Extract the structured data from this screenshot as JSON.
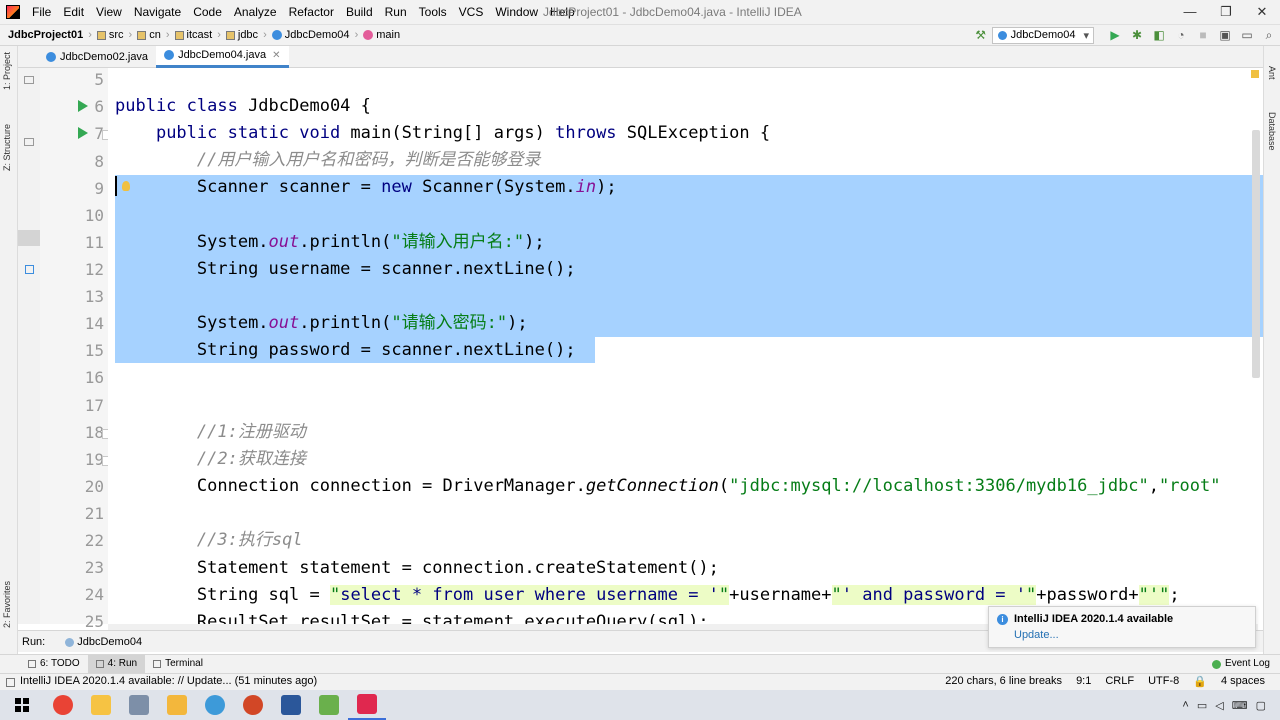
{
  "window": {
    "title": "JdbcProject01 - JdbcDemo04.java - IntelliJ IDEA",
    "menu": [
      "File",
      "Edit",
      "View",
      "Navigate",
      "Code",
      "Analyze",
      "Refactor",
      "Build",
      "Run",
      "Tools",
      "VCS",
      "Window",
      "Help"
    ],
    "controls": {
      "minimize": "—",
      "maximize": "❐",
      "close": "✕"
    }
  },
  "breadcrumb": {
    "project": "JdbcProject01",
    "items": [
      "src",
      "cn",
      "itcast",
      "jdbc",
      "JdbcDemo04",
      "main"
    ]
  },
  "toolbar": {
    "run_config": "JdbcDemo04",
    "icons": [
      "hammer-icon",
      "run-icon",
      "debug-icon",
      "coverage-icon",
      "profile-icon",
      "stop-icon",
      "project-structure-icon",
      "layout-icon",
      "search-icon"
    ]
  },
  "tabs": [
    {
      "label": "JdbcDemo02.java",
      "active": false
    },
    {
      "label": "JdbcDemo04.java",
      "active": true
    }
  ],
  "left_tool_labels": {
    "project": "1: Project",
    "structure": "Z: Structure",
    "favorites": "2: Favorites"
  },
  "right_tool_labels": {
    "ant": "Ant",
    "database": "Database"
  },
  "editor": {
    "line_numbers": [
      "5",
      "6",
      "7",
      "8",
      "9",
      "10",
      "11",
      "12",
      "13",
      "14",
      "15",
      "16",
      "17",
      "18",
      "19",
      "20",
      "21",
      "22",
      "23",
      "24",
      "25"
    ],
    "lines": {
      "l6": {
        "kw1": "public class ",
        "rest": "JdbcDemo04 {"
      },
      "l7": {
        "kw1": "public static void ",
        "a": "main(String[] args) ",
        "kw2": "throws ",
        "b": "SQLException {"
      },
      "l8": {
        "cmt": "//用户输入用户名和密码，判断是否能够登录"
      },
      "l9": {
        "a": "Scanner scanner = ",
        "kw": "new ",
        "b": "Scanner(System.",
        "fld": "in",
        "c": ");"
      },
      "l11": {
        "a": "System.",
        "fld": "out",
        "b": ".println(",
        "str": "\"请输入用户名:\"",
        "c": ");"
      },
      "l12": {
        "a": "String username = scanner.nextLine();"
      },
      "l14": {
        "a": "System.",
        "fld": "out",
        "b": ".println(",
        "str": "\"请输入密码:\"",
        "c": ");"
      },
      "l15": {
        "a": "String password = scanner.nextLine();"
      },
      "l18": {
        "cmt": "//1:注册驱动"
      },
      "l19": {
        "cmt": "//2:获取连接"
      },
      "l20": {
        "a": "Connection connection = DriverManager.",
        "mth": "getConnection",
        "b": "(",
        "str": "\"jdbc:mysql://localhost:3306/mydb16_jdbc\"",
        "c": ",",
        "str2": "\"root\""
      },
      "l22": {
        "cmt": "//3:执行sql"
      },
      "l23": {
        "a": "Statement statement = connection.createStatement();"
      },
      "l24": {
        "a": "String sql = ",
        "str1": "\"",
        "sqlkw": "select * from user where username = '",
        "str2": "\"",
        "b": "+username+",
        "str3": "\"",
        "sqlkw2": "' and password = '",
        "str4": "\"",
        "c": "+password+",
        "str5": "\"'\"",
        "d": ";"
      },
      "l25": {
        "a": "ResultSet resultSet = statement.executeQuery(sql);"
      }
    }
  },
  "run_panel": {
    "label": "Run:",
    "tab": "JdbcDemo04"
  },
  "bottom_tools": [
    {
      "label": "6: TODO",
      "active": false
    },
    {
      "label": "4: Run",
      "active": true
    },
    {
      "label": "Terminal",
      "active": false
    }
  ],
  "event_log": "Event Log",
  "notification": {
    "title": "IntelliJ IDEA 2020.1.4 available",
    "link": "Update..."
  },
  "status": {
    "message": "IntelliJ IDEA 2020.1.4 available: // Update... (51 minutes ago)",
    "chars": "220 chars, 6 line breaks",
    "position": "9:1",
    "line_sep": "CRLF",
    "encoding": "UTF-8",
    "indent": "4 spaces"
  },
  "taskbar": {
    "apps": [
      {
        "name": "chrome-icon",
        "color": "#e94335"
      },
      {
        "name": "file-explorer-icon",
        "color": "#f6c343"
      },
      {
        "name": "app-icon-3",
        "color": "#7d8fa8"
      },
      {
        "name": "app-icon-4",
        "color": "#f3b73c"
      },
      {
        "name": "app-icon-5",
        "color": "#3d9ad9"
      },
      {
        "name": "powerpoint-icon",
        "color": "#d24726"
      },
      {
        "name": "word-icon",
        "color": "#2b579a"
      },
      {
        "name": "app-icon-8",
        "color": "#6ab04c"
      },
      {
        "name": "intellij-icon",
        "color": "#e0284f"
      }
    ]
  }
}
